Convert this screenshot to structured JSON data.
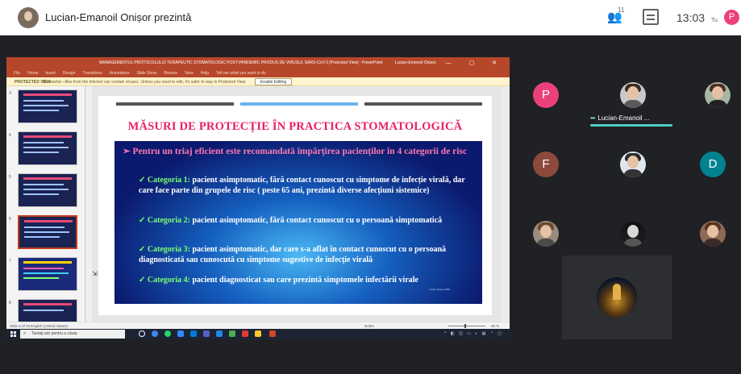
{
  "meet": {
    "presenter_title": "Lucian-Emanoil Onișor prezintă",
    "participants_count": "11",
    "clock": "13:03",
    "self_label": "Tu",
    "self_initial": "P",
    "icons": {
      "people": "people-icon",
      "chat": "chat-icon"
    }
  },
  "ppt": {
    "document_title": "MANAGEMENTUL PROTOCOLULUI TERAPEUTIC STOMATOLOGIC POST-PANDEMIC PRODUS DE VIRUSUL SARS-CoV-2 [Protected View] - PowerPoint",
    "user": "Lucian-Emanoil Onisor",
    "ribbon_tabs": [
      "File",
      "Home",
      "Insert",
      "Design",
      "Transitions",
      "Animations",
      "Slide Show",
      "Review",
      "View",
      "Help",
      "Tell me what you want to do"
    ],
    "protected_label": "PROTECTED VIEW",
    "protected_text": "Be careful—files from the Internet can contain viruses. Unless you need to edit, it's safer to stay in Protected View.",
    "enable_editing": "Enable Editing",
    "thumb_numbers": [
      "3",
      "4",
      "5",
      "6",
      "7",
      "8"
    ],
    "status_slide": "Slide 6 of 15",
    "status_lang": "English (United States)",
    "status_notes": "Notes",
    "status_zoom": "95 %"
  },
  "slide": {
    "title": "MĂSURI DE PROTECȚIE ÎN PRACTICA STOMATOLOGICĂ",
    "intro": "➢ Pentru un triaj eficient este recomandată împărțirea pacienților în 4 categorii de risc",
    "items": [
      {
        "check": "✓",
        "cat": "Categoria 1:",
        "text": "pacient asimptomatic, fără contact cunoscut  cu simptome de infecție virală, dar care face parte din grupele de risc ( peste 65 ani, prezintă diverse afecțiuni sistemice)"
      },
      {
        "check": "✓",
        "cat": "Categoria 2:",
        "text": "pacient asimptomatic, fără contact cunoscut cu o persoană simptomatică"
      },
      {
        "check": "✓",
        "cat": "Categoria 3:",
        "text": "pacient asimptomatic, dar care s-a aflat în contact cunoscut cu o persoană diagnosticată sau cunoscută cu simptome sugestive de infecție virală"
      },
      {
        "check": "✓",
        "cat": "Categoria 4:",
        "text": "pacient diagnosticat sau care prezintă simptomele infectării virale"
      }
    ],
    "footer": "Lucian Onișor 2020"
  },
  "taskbar": {
    "search_placeholder": "Tastați aici pentru a căuta"
  },
  "participants": {
    "tile_1_initial": "P",
    "tile_4_initial": "F",
    "tile_6_initial": "D",
    "speaking_name": "Lucian-Emanoil ...",
    "speaking_dots": "•••",
    "colors": {
      "pink": "#ec407a",
      "brown": "#8d4a3c",
      "teal": "#00838f",
      "speaking": "#4ecdc4"
    }
  }
}
